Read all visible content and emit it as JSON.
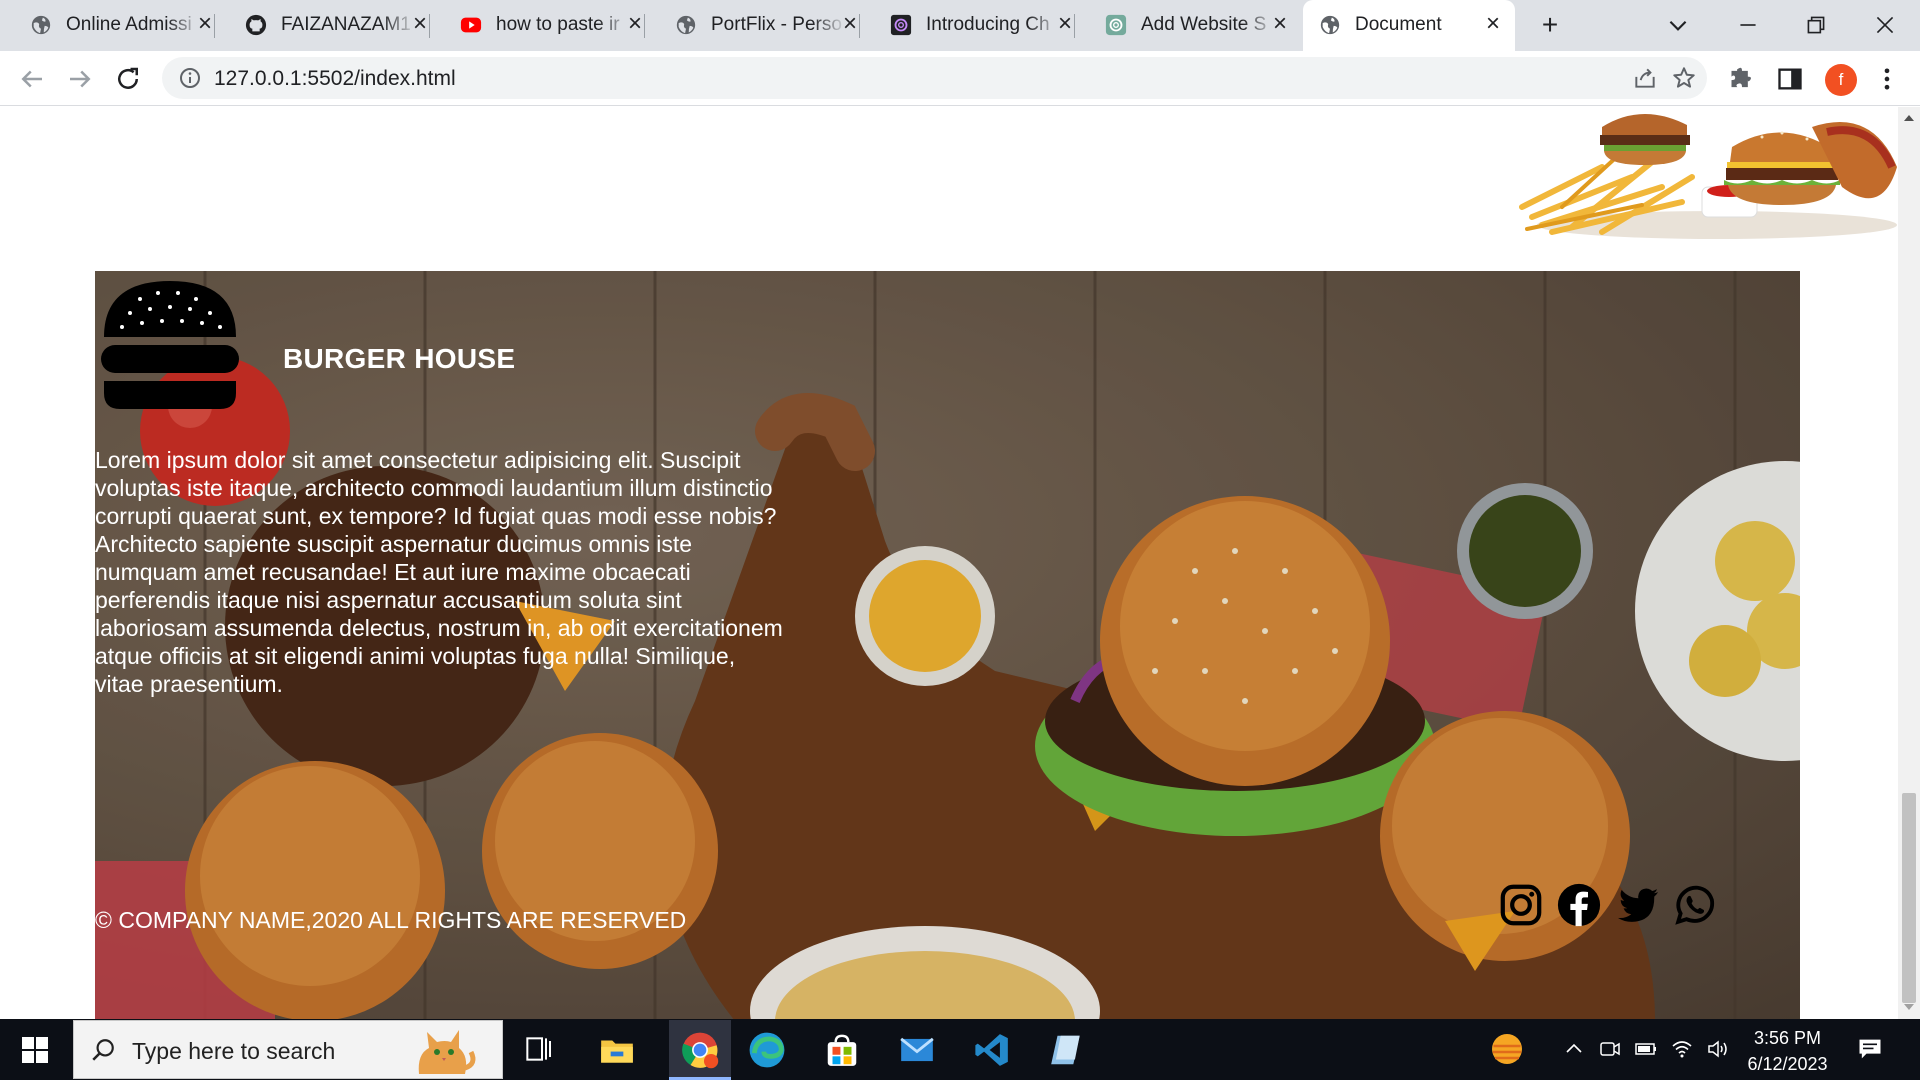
{
  "browser": {
    "tabs": [
      {
        "title": "Online Admissi",
        "icon": "globe-icon"
      },
      {
        "title": "FAIZANAZAM1",
        "icon": "github-icon"
      },
      {
        "title": "how to paste ir",
        "icon": "youtube-icon"
      },
      {
        "title": "PortFlix - Perso",
        "icon": "globe-icon"
      },
      {
        "title": "Introducing Ch",
        "icon": "openai-icon"
      },
      {
        "title": "Add Website S",
        "icon": "chatgpt-icon"
      },
      {
        "title": "Document",
        "icon": "globe-icon",
        "active": true
      }
    ],
    "url": "127.0.0.1:5502/index.html",
    "profile_initial": "f",
    "profile_color": "#f25022"
  },
  "page": {
    "footer": {
      "brand_name": "BURGER HOUSE",
      "about_text": "Lorem ipsum dolor sit amet consectetur adipisicing elit. Suscipit voluptas iste itaque, architecto commodi laudantium illum distinctio corrupti quaerat sunt, ex tempore? Id fugiat quas modi esse nobis? Architecto sapiente suscipit aspernatur ducimus omnis iste numquam amet recusandae! Et aut iure maxime obcaecati perferendis itaque nisi aspernatur accusantium soluta sint laboriosam assumenda delectus, nostrum in, ab odit exercitationem atque officiis at sit eligendi animi voluptas fuga nulla! Similique, vitae praesentium.",
      "copyright": "© COMPANY NAME,2020 ALL RIGHTS ARE RESERVED",
      "socials": [
        "instagram-icon",
        "facebook-icon",
        "twitter-icon",
        "whatsapp-icon"
      ]
    }
  },
  "taskbar": {
    "search_placeholder": "Type here to search",
    "time": "3:56 PM",
    "date": "6/12/2023"
  }
}
